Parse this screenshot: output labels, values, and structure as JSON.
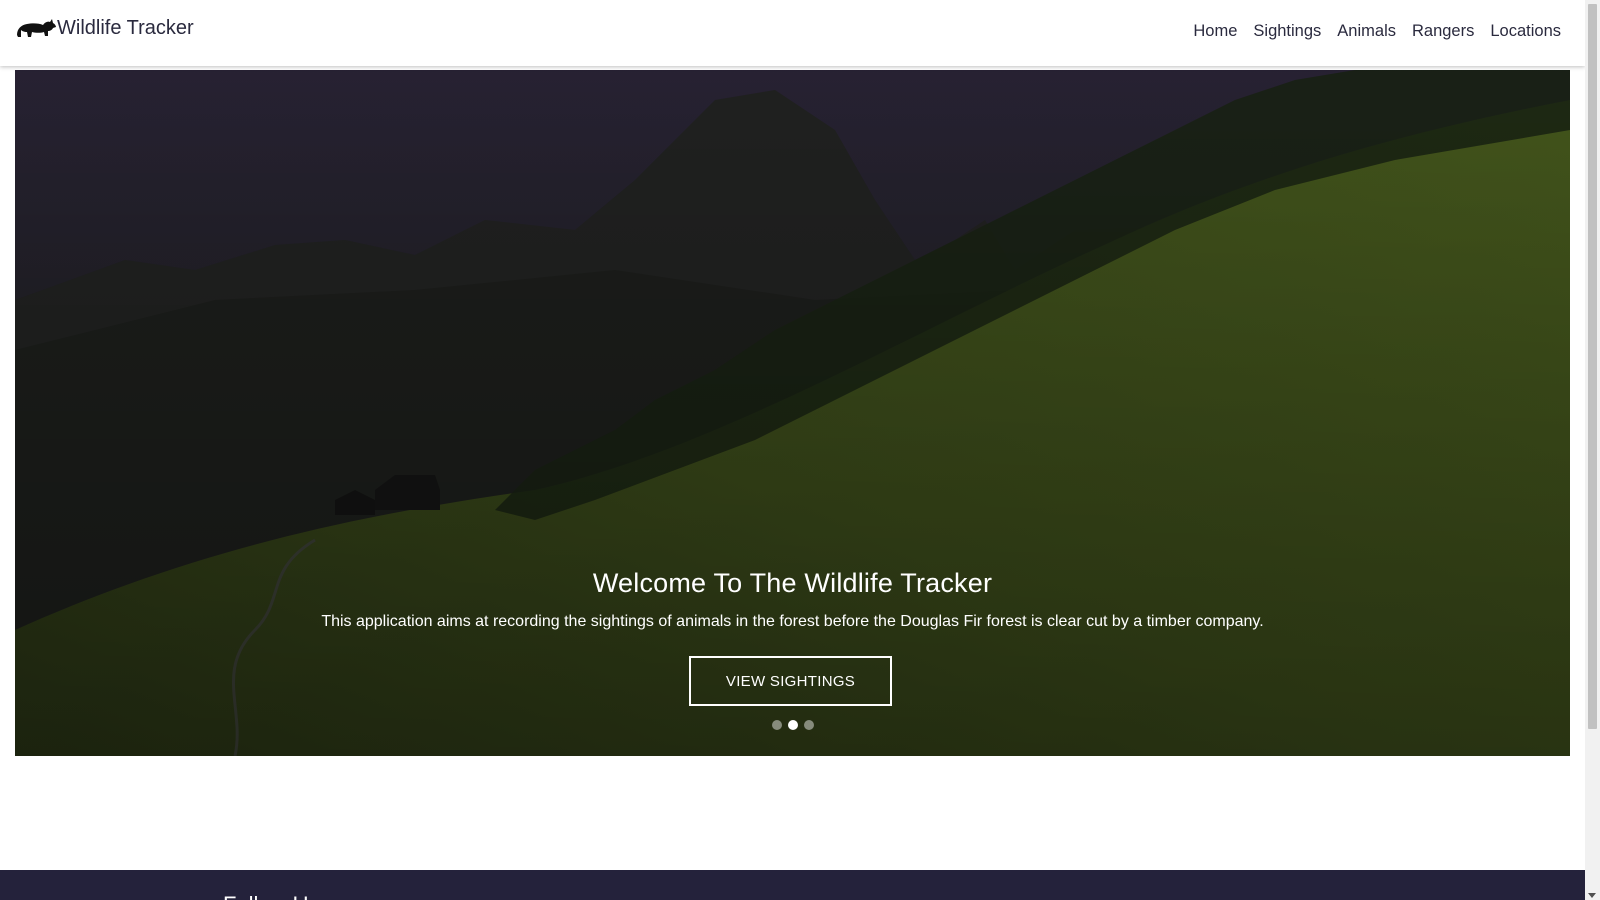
{
  "app": {
    "brand_text": "Wildlife Tracker",
    "logo_icon": "rhino-icon"
  },
  "nav": {
    "items": [
      {
        "label": "Home"
      },
      {
        "label": "Sightings"
      },
      {
        "label": "Animals"
      },
      {
        "label": "Rangers"
      },
      {
        "label": "Locations"
      }
    ]
  },
  "hero": {
    "title": "Welcome To The Wildlife Tracker",
    "description": "This application aims at recording the sightings of animals in the forest before the Douglas Fir forest is clear cut by a timber company.",
    "cta_label": "VIEW SIGHTINGS",
    "slides_total": 3,
    "active_slide": 2
  },
  "footer": {
    "title": "Follow Us"
  },
  "colors": {
    "nav_text": "#2a2a3e",
    "footer_bg": "#24223b",
    "hero_overlay": "#000000"
  }
}
